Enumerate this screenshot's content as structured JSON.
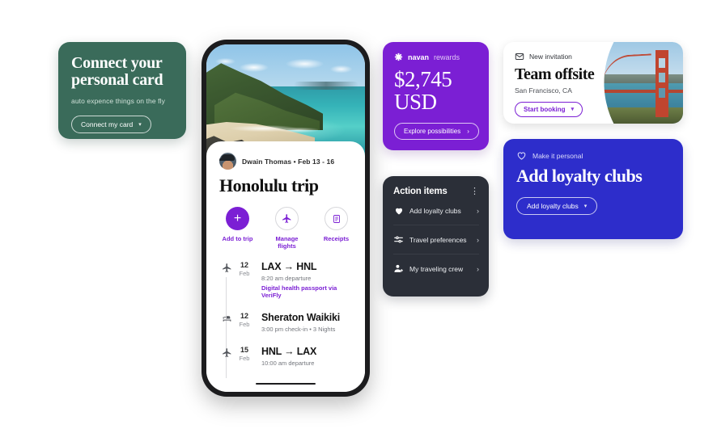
{
  "green_card": {
    "title": "Connect your personal card",
    "subtitle": "auto expence things on the fly",
    "button_label": "Connect my card",
    "caret": "▾",
    "color": "#3a6b5a"
  },
  "phone": {
    "hero_image": "hawaii-beach-photo",
    "byline": "Dwain Thomas • Feb 13 - 16",
    "trip_title": "Honolulu trip",
    "quick_actions": [
      {
        "label": "Add to trip",
        "icon": "plus-icon"
      },
      {
        "label": "Manage flights",
        "icon": "airplane-icon"
      },
      {
        "label": "Receipts",
        "icon": "receipt-icon"
      }
    ],
    "itinerary": [
      {
        "icon": "airplane-icon",
        "day": "12",
        "month": "Feb",
        "title": "LAX → HNL",
        "subtitle": "8:20 am departure",
        "link": "Digital health passport via VeriFly"
      },
      {
        "icon": "bed-icon",
        "day": "12",
        "month": "Feb",
        "title": "Sheraton Waikiki",
        "subtitle": "3:00 pm check-in • 3 Nights",
        "link": ""
      },
      {
        "icon": "airplane-icon",
        "day": "15",
        "month": "Feb",
        "title": "HNL → LAX",
        "subtitle": "10:00 am departure",
        "link": ""
      }
    ]
  },
  "rewards": {
    "brand": "navan",
    "brand_word": "rewards",
    "amount_line1": "$2,745",
    "amount_line2": "USD",
    "button_label": "Explore possibilities",
    "chevron": "›",
    "color": "#7b1fd4"
  },
  "action_items": {
    "title": "Action items",
    "menu_icon": "kebab-menu-icon",
    "color": "#2b2f38",
    "items": [
      {
        "label": "Add loyalty clubs",
        "icon": "heart-icon",
        "chevron": "›"
      },
      {
        "label": "Travel preferences",
        "icon": "sliders-icon",
        "chevron": "›"
      },
      {
        "label": "My traveling crew",
        "icon": "person-add-icon",
        "chevron": "›"
      }
    ]
  },
  "invitation": {
    "kicker": "New invitation",
    "kicker_icon": "envelope-icon",
    "title": "Team offsite",
    "subtitle": "San Francisco, CA",
    "button_label": "Start booking",
    "caret": "▾",
    "image": "golden-gate-bridge-photo",
    "accent": "#7b1fd4"
  },
  "loyalty": {
    "kicker": "Make it personal",
    "kicker_icon": "heart-outline-icon",
    "title": "Add loyalty clubs",
    "button_label": "Add loyalty clubs",
    "caret": "▾",
    "color": "#2d2dcb"
  }
}
